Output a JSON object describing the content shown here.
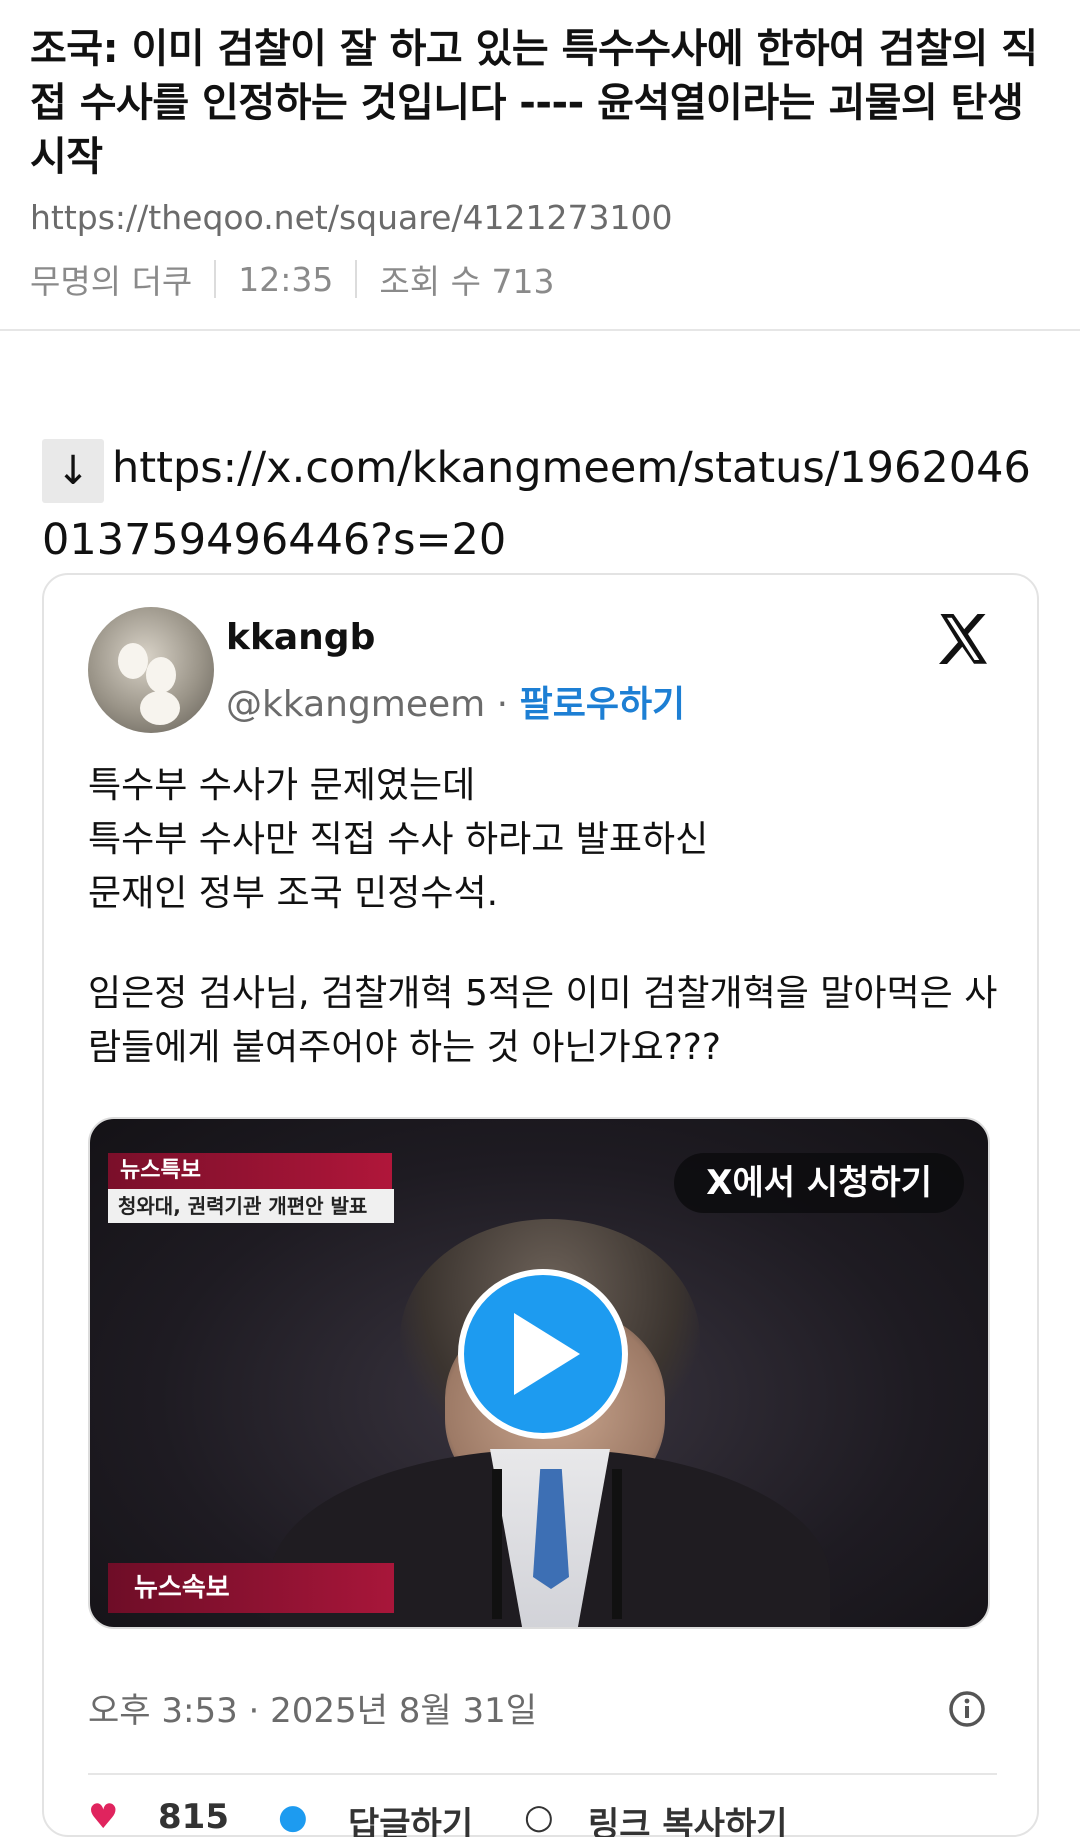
{
  "post": {
    "title": "조국: 이미 검찰이 잘 하고 있는 특수수사에 한하여 검찰의 직접 수사를 인정하는 것입니다 ---- 윤석열이라는 괴물의 탄생 시작",
    "url": "https://theqoo.net/square/4121273100",
    "author": "무명의 더쿠",
    "time": "12:35",
    "views": "조회 수 713"
  },
  "embed": {
    "arrow": "↓",
    "link": "https://x.com/kkangmeem/status/1962046013759496446?s=20"
  },
  "tweet": {
    "display_name": "kkangb",
    "handle": "@kkangmeem",
    "separator": " · ",
    "follow_label": "팔로우하기",
    "lines1": [
      "특수부 수사가 문제였는데",
      "특수부 수사만 직접 수사 하라고 발표하신",
      "문재인 정부 조국 민정수석."
    ],
    "para2": "임은정 검사님, 검찰개혁 5적은 이미 검찰개혁을 말아먹은 사람들에게 붙여주어야 하는 것 아닌가요???",
    "timestamp": "오후 3:53 · 2025년 8월 31일"
  },
  "video": {
    "banner_top": "뉴스특보",
    "banner_sub": "청와대, 권력기관 개편안 발표",
    "banner_bottom": "뉴스속보",
    "watch_label": "X에서 시청하기",
    "accent_color": "#1d9bf0"
  },
  "actions": {
    "like_count": "815",
    "reply_label": "답글하기",
    "copy_label": "링크 복사하기"
  }
}
